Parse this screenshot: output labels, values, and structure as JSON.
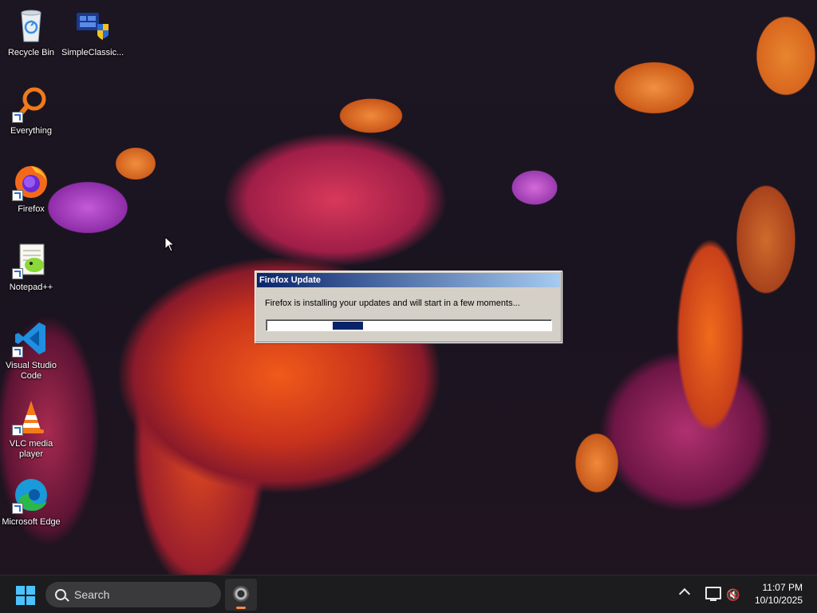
{
  "desktop": {
    "icons": [
      {
        "label": "Recycle Bin",
        "icon": "recycle-bin-icon"
      },
      {
        "label": "SimpleClassic...",
        "icon": "simpleclassic-icon"
      },
      {
        "label": "Everything",
        "icon": "everything-search-icon"
      },
      {
        "label": "Firefox",
        "icon": "firefox-icon"
      },
      {
        "label": "Notepad++",
        "icon": "notepad-plus-plus-icon"
      },
      {
        "label": "Visual Studio Code",
        "icon": "vscode-icon"
      },
      {
        "label": "VLC media player",
        "icon": "vlc-icon"
      },
      {
        "label": "Microsoft Edge",
        "icon": "edge-icon"
      }
    ]
  },
  "dialog": {
    "title": "Firefox Update",
    "message": "Firefox is installing your updates and will start in a few moments...",
    "progress_style": "indeterminate"
  },
  "taskbar": {
    "search_placeholder": "Search",
    "pinned_app_icon": "firefox-updater-icon",
    "clock_time": "11:07 PM",
    "clock_date": "10/10/2025"
  },
  "colors": {
    "dialog_title_start": "#0a246a",
    "dialog_title_end": "#a6caf0",
    "dialog_face": "#d4d0c8",
    "progress_fill": "#0a246a",
    "taskbar_bg": "#1c1c1e",
    "start_accent": "#4cc2ff"
  }
}
